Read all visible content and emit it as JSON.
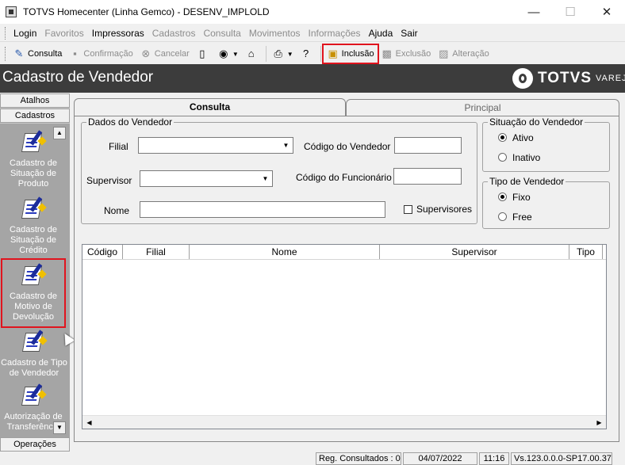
{
  "window": {
    "title": "TOTVS Homecenter (Linha Gemco) - DESENV_IMPLOLD",
    "min_glyph": "—",
    "max_glyph": "☐",
    "close_glyph": "✕"
  },
  "menu": [
    "Login",
    "Favoritos",
    "Impressoras",
    "Cadastros",
    "Consulta",
    "Movimentos",
    "Informações",
    "Ajuda",
    "Sair"
  ],
  "toolbar": {
    "consulta": "Consulta",
    "confirmacao": "Confirmação",
    "cancelar": "Cancelar",
    "inclusao": "Inclusão",
    "exclusao": "Exclusão",
    "alteracao": "Alteração"
  },
  "header": {
    "title": "Cadastro de Vendedor",
    "logo_text": "TOTVS",
    "logo_sub": "VAREJO"
  },
  "sidebar": {
    "tab_atalhos": "Atalhos",
    "tab_cadastros": "Cadastros",
    "tab_operacoes": "Operações",
    "items": [
      {
        "label": "Cadastro de Situação de Produto"
      },
      {
        "label": "Cadastro de Situação de Crédito"
      },
      {
        "label": "Cadastro de Motivo de Devolução"
      },
      {
        "label": "Cadastro de Tipo de Vendedor"
      },
      {
        "label": "Autorização de Transferência"
      }
    ]
  },
  "tabs": {
    "consulta": "Consulta",
    "principal": "Principal"
  },
  "form": {
    "dados_legend": "Dados do Vendedor",
    "filial_label": "Filial",
    "supervisor_label": "Supervisor",
    "nome_label": "Nome",
    "codigo_vendedor_label": "Código do Vendedor",
    "codigo_funcionario_label": "Código do Funcionário",
    "supervisores_label": "Supervisores",
    "situacao_legend": "Situação do Vendedor",
    "ativo_label": "Ativo",
    "inativo_label": "Inativo",
    "tipo_legend": "Tipo de Vendedor",
    "fixo_label": "Fixo",
    "free_label": "Free"
  },
  "grid": {
    "columns": [
      "Código",
      "Filial",
      "Nome",
      "Supervisor",
      "Tipo"
    ]
  },
  "status": {
    "reg": "Reg. Consultados : 0",
    "date": "04/07/2022",
    "time": "11:16",
    "version": "Vs.123.0.0.0-SP17.00.37"
  }
}
